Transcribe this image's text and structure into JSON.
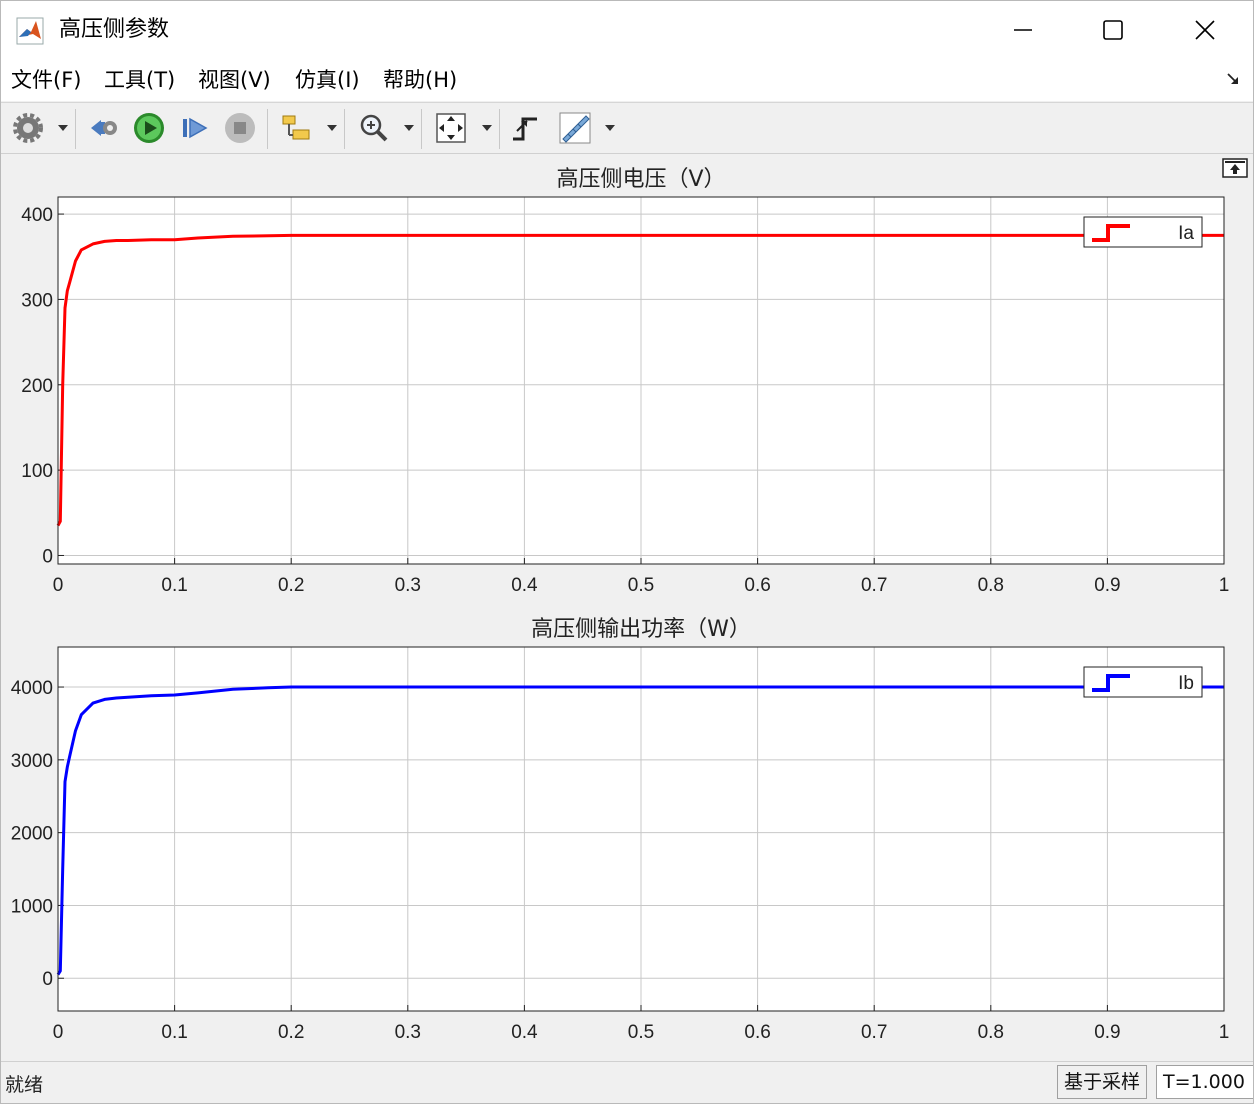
{
  "window": {
    "title": "高压侧参数"
  },
  "menu": [
    {
      "label": "文件(F)"
    },
    {
      "label": "工具(T)"
    },
    {
      "label": "视图(V)"
    },
    {
      "label": "仿真(I)"
    },
    {
      "label": "帮助(H)"
    }
  ],
  "toolbar": {
    "icons": [
      "settings-icon",
      "restore-icon",
      "run-icon",
      "step-forward-icon",
      "stop-icon",
      "highlight-icon",
      "zoom-icon",
      "fit-view-icon",
      "triggers-icon",
      "measure-icon"
    ]
  },
  "status": {
    "text": "就绪",
    "mode": "基于采样",
    "time": "T=1.000"
  },
  "colors": {
    "series_a": "#ff0000",
    "series_b": "#0000ff",
    "grid": "#d0d0d0"
  },
  "chart_data": [
    {
      "type": "line",
      "title": "高压侧电压（V）",
      "xlim": [
        0,
        1
      ],
      "ylim": [
        -10,
        420
      ],
      "xticks": [
        0,
        0.1,
        0.2,
        0.3,
        0.4,
        0.5,
        0.6,
        0.7,
        0.8,
        0.9,
        1
      ],
      "xtick_labels": [
        "0",
        "0.1",
        "0.2",
        "0.3",
        "0.4",
        "0.5",
        "0.6",
        "0.7",
        "0.8",
        "0.9",
        "1"
      ],
      "yticks": [
        0,
        100,
        200,
        300,
        400
      ],
      "ytick_labels": [
        "0",
        "100",
        "200",
        "300",
        "400"
      ],
      "grid": true,
      "legend_position": "top-right",
      "series": [
        {
          "name": "Ia",
          "color": "#ff0000",
          "x": [
            0,
            0.002,
            0.004,
            0.006,
            0.008,
            0.01,
            0.015,
            0.02,
            0.03,
            0.04,
            0.05,
            0.06,
            0.08,
            0.1,
            0.12,
            0.15,
            0.2,
            0.3,
            0.4,
            0.5,
            0.6,
            0.7,
            0.8,
            0.9,
            1.0
          ],
          "y": [
            35,
            40,
            200,
            290,
            310,
            320,
            345,
            358,
            365,
            368,
            369,
            369,
            370,
            370,
            372,
            374,
            375,
            375,
            375,
            375,
            375,
            375,
            375,
            375,
            375
          ]
        }
      ]
    },
    {
      "type": "line",
      "title": "高压侧输出功率（W）",
      "xlim": [
        0,
        1
      ],
      "ylim": [
        -450,
        4550
      ],
      "xticks": [
        0,
        0.1,
        0.2,
        0.3,
        0.4,
        0.5,
        0.6,
        0.7,
        0.8,
        0.9,
        1
      ],
      "xtick_labels": [
        "0",
        "0.1",
        "0.2",
        "0.3",
        "0.4",
        "0.5",
        "0.6",
        "0.7",
        "0.8",
        "0.9",
        "1"
      ],
      "yticks": [
        0,
        1000,
        2000,
        3000,
        4000
      ],
      "ytick_labels": [
        "0",
        "1000",
        "2000",
        "3000",
        "4000"
      ],
      "grid": true,
      "legend_position": "top-right",
      "series": [
        {
          "name": "Ib",
          "color": "#0000ff",
          "x": [
            0,
            0.002,
            0.004,
            0.006,
            0.008,
            0.01,
            0.015,
            0.02,
            0.03,
            0.04,
            0.05,
            0.06,
            0.08,
            0.1,
            0.12,
            0.15,
            0.18,
            0.2,
            0.3,
            0.4,
            0.5,
            0.6,
            0.7,
            0.8,
            0.9,
            1.0
          ],
          "y": [
            50,
            100,
            1500,
            2700,
            2900,
            3050,
            3400,
            3620,
            3780,
            3830,
            3850,
            3860,
            3880,
            3890,
            3920,
            3970,
            3990,
            4000,
            4000,
            4000,
            4000,
            4000,
            4000,
            4000,
            4000,
            4000
          ]
        }
      ]
    }
  ]
}
